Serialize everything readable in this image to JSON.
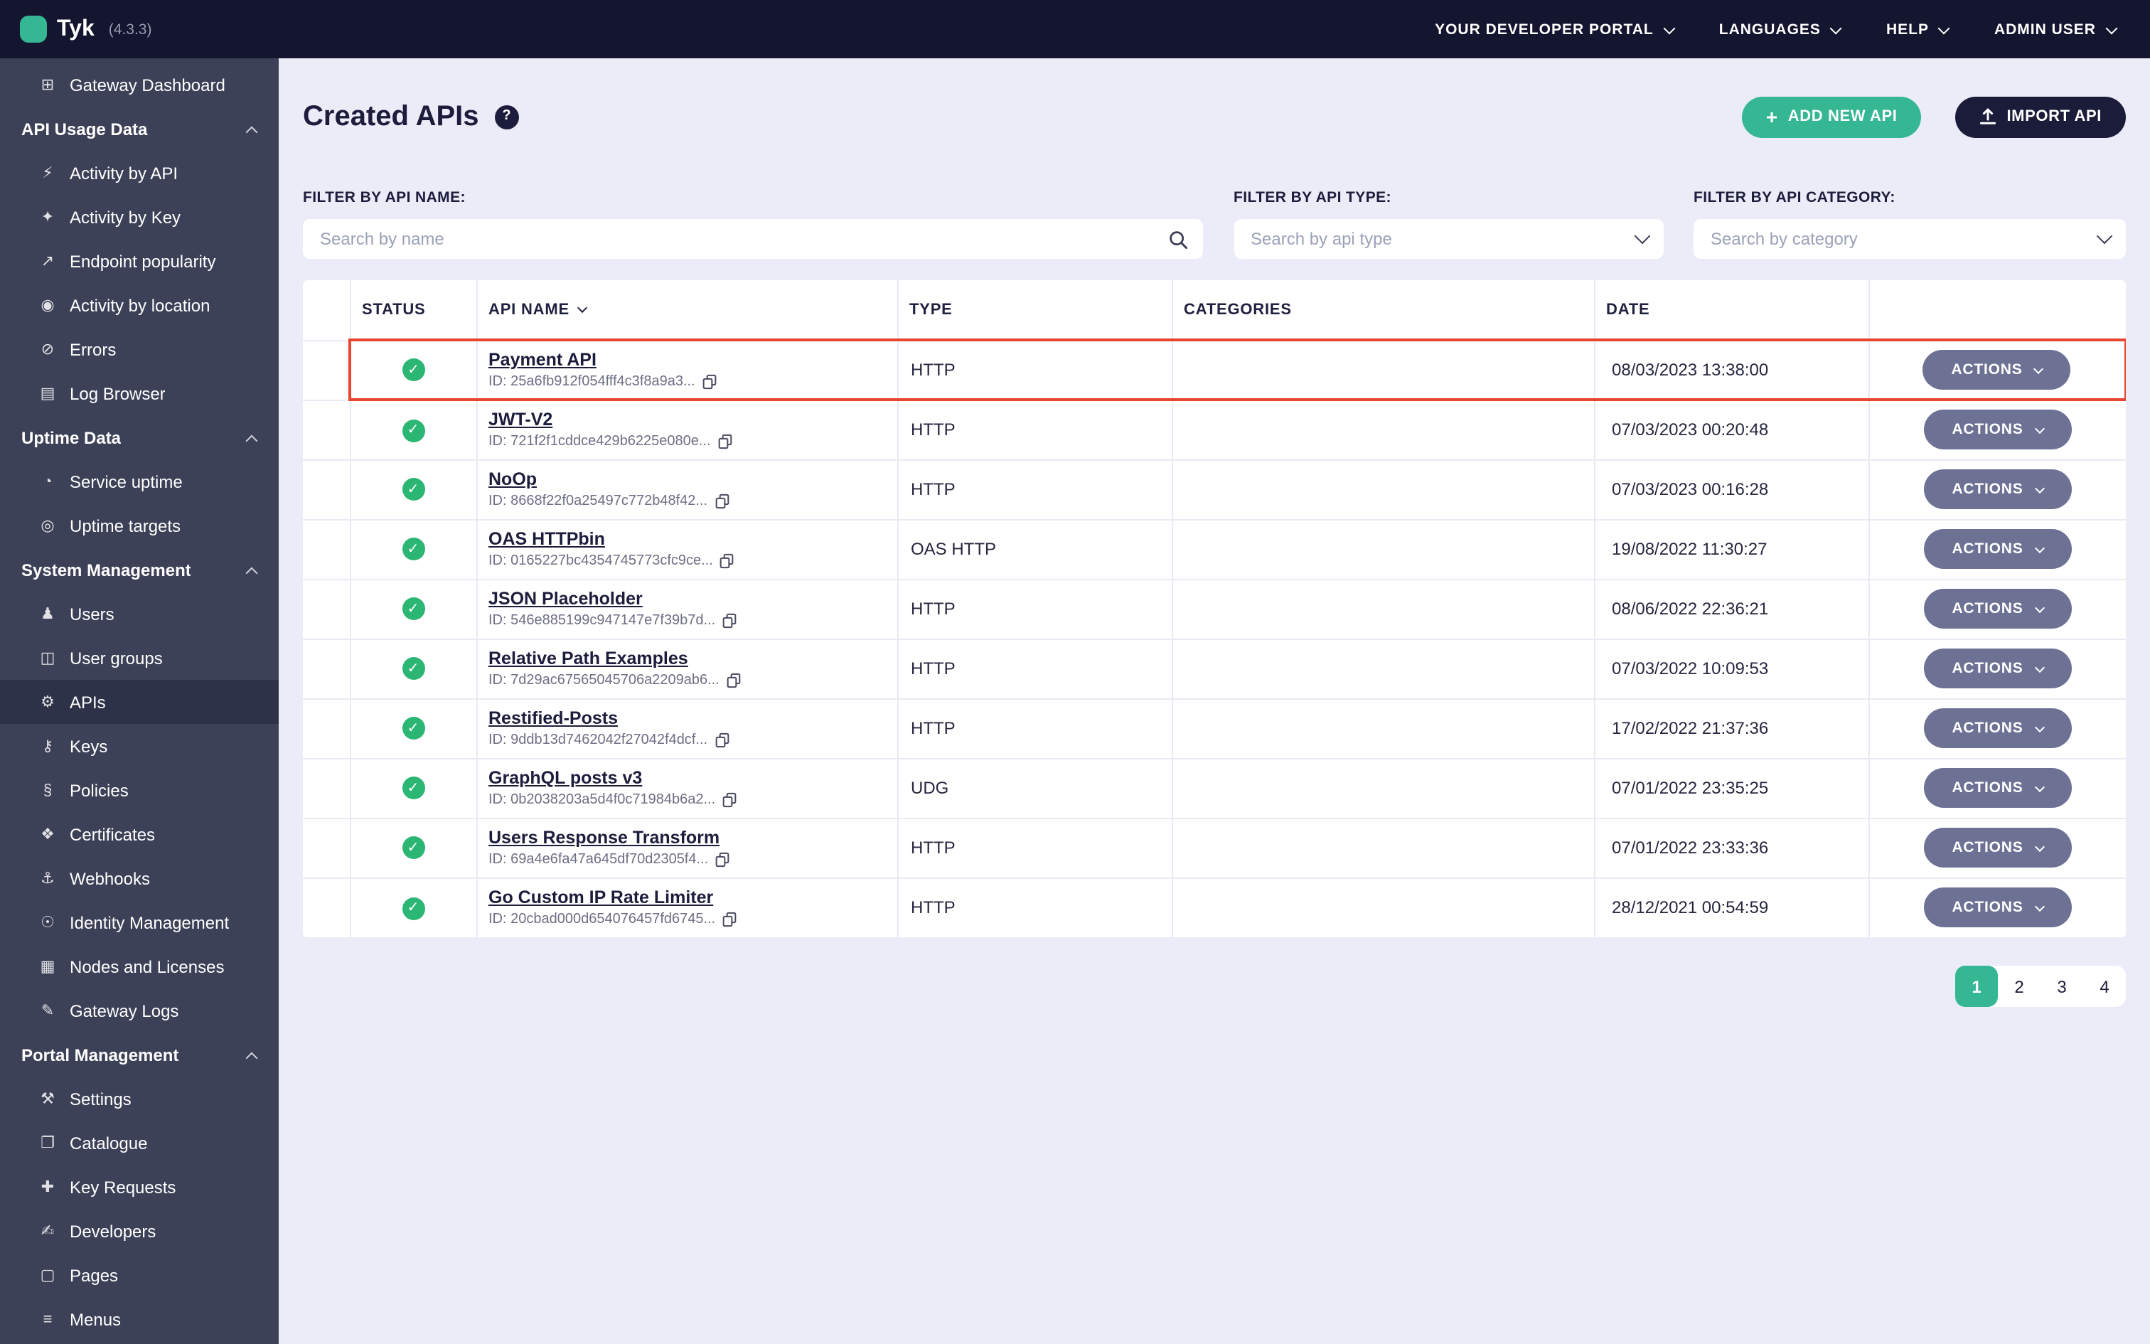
{
  "topbar": {
    "logo_text": "Tyk",
    "version": "(4.3.3)",
    "menu": [
      {
        "label": "YOUR DEVELOPER PORTAL",
        "name": "developer-portal"
      },
      {
        "label": "LANGUAGES",
        "name": "languages"
      },
      {
        "label": "HELP",
        "name": "help"
      },
      {
        "label": "ADMIN USER",
        "name": "admin-user"
      }
    ]
  },
  "sidebar": {
    "items": [
      {
        "type": "link",
        "name": "gateway-dashboard",
        "label": "Gateway Dashboard",
        "glyph": "⊞"
      },
      {
        "type": "section",
        "name": "api-usage-data",
        "label": "API Usage Data"
      },
      {
        "type": "link",
        "name": "activity-by-api",
        "label": "Activity by API",
        "glyph": "⚡"
      },
      {
        "type": "link",
        "name": "activity-by-key",
        "label": "Activity by Key",
        "glyph": "✦"
      },
      {
        "type": "link",
        "name": "endpoint-popularity",
        "label": "Endpoint popularity",
        "glyph": "↗"
      },
      {
        "type": "link",
        "name": "activity-by-location",
        "label": "Activity by location",
        "glyph": "◉"
      },
      {
        "type": "link",
        "name": "errors",
        "label": "Errors",
        "glyph": "⊘"
      },
      {
        "type": "link",
        "name": "log-browser",
        "label": "Log Browser",
        "glyph": "▤"
      },
      {
        "type": "section",
        "name": "uptime-data",
        "label": "Uptime Data"
      },
      {
        "type": "link",
        "name": "service-uptime",
        "label": "Service uptime",
        "glyph": "◔"
      },
      {
        "type": "link",
        "name": "uptime-targets",
        "label": "Uptime targets",
        "glyph": "◎"
      },
      {
        "type": "section",
        "name": "system-management",
        "label": "System Management"
      },
      {
        "type": "link",
        "name": "users",
        "label": "Users",
        "glyph": "♟"
      },
      {
        "type": "link",
        "name": "user-groups",
        "label": "User groups",
        "glyph": "◫"
      },
      {
        "type": "link",
        "name": "apis",
        "label": "APIs",
        "glyph": "⚙",
        "active": true
      },
      {
        "type": "link",
        "name": "keys",
        "label": "Keys",
        "glyph": "⚷"
      },
      {
        "type": "link",
        "name": "policies",
        "label": "Policies",
        "glyph": "§"
      },
      {
        "type": "link",
        "name": "certificates",
        "label": "Certificates",
        "glyph": "❖"
      },
      {
        "type": "link",
        "name": "webhooks",
        "label": "Webhooks",
        "glyph": "⚓"
      },
      {
        "type": "link",
        "name": "identity-management",
        "label": "Identity Management",
        "glyph": "☉"
      },
      {
        "type": "link",
        "name": "nodes-and-licenses",
        "label": "Nodes and Licenses",
        "glyph": "▦"
      },
      {
        "type": "link",
        "name": "gateway-logs",
        "label": "Gateway Logs",
        "glyph": "✎"
      },
      {
        "type": "section",
        "name": "portal-management",
        "label": "Portal Management"
      },
      {
        "type": "link",
        "name": "settings",
        "label": "Settings",
        "glyph": "⚒"
      },
      {
        "type": "link",
        "name": "catalogue",
        "label": "Catalogue",
        "glyph": "❐"
      },
      {
        "type": "link",
        "name": "key-requests",
        "label": "Key Requests",
        "glyph": "✚"
      },
      {
        "type": "link",
        "name": "developers",
        "label": "Developers",
        "glyph": "✍"
      },
      {
        "type": "link",
        "name": "pages",
        "label": "Pages",
        "glyph": "▢"
      },
      {
        "type": "link",
        "name": "menus",
        "label": "Menus",
        "glyph": "≡"
      }
    ]
  },
  "header": {
    "title": "Created APIs",
    "help": "?"
  },
  "buttons": {
    "add_new_api": {
      "label": "ADD NEW API",
      "icon": "+"
    },
    "import_api": {
      "label": "IMPORT API"
    }
  },
  "filters": [
    {
      "label": "FILTER BY API NAME:",
      "placeholder": "Search by name"
    },
    {
      "label": "FILTER BY API TYPE:",
      "placeholder": "Search by api type"
    },
    {
      "label": "FILTER BY API CATEGORY:",
      "placeholder": "Search by category"
    }
  ],
  "table": {
    "columns": [
      "",
      "STATUS",
      "API NAME",
      "TYPE",
      "CATEGORIES",
      "DATE",
      ""
    ],
    "actions_label": "ACTIONS",
    "rows": [
      {
        "name": "Payment API",
        "id": "ID: 25a6fb912f054fff4c3f8a9a3...",
        "type": "HTTP",
        "categories": "",
        "date": "08/03/2023 13:38:00",
        "status": "ok",
        "highlighted": true
      },
      {
        "name": "JWT-V2",
        "id": "ID: 721f2f1cddce429b6225e080e...",
        "type": "HTTP",
        "categories": "",
        "date": "07/03/2023 00:20:48",
        "status": "ok"
      },
      {
        "name": "NoOp",
        "id": "ID: 8668f22f0a25497c772b48f42...",
        "type": "HTTP",
        "categories": "",
        "date": "07/03/2023 00:16:28",
        "status": "ok"
      },
      {
        "name": "OAS HTTPbin",
        "id": "ID: 0165227bc4354745773cfc9ce...",
        "type": "OAS HTTP",
        "categories": "",
        "date": "19/08/2022 11:30:27",
        "status": "ok"
      },
      {
        "name": "JSON Placeholder",
        "id": "ID: 546e885199c947147e7f39b7d...",
        "type": "HTTP",
        "categories": "",
        "date": "08/06/2022 22:36:21",
        "status": "ok"
      },
      {
        "name": "Relative Path Examples",
        "id": "ID: 7d29ac67565045706a2209ab6...",
        "type": "HTTP",
        "categories": "",
        "date": "07/03/2022 10:09:53",
        "status": "ok"
      },
      {
        "name": "Restified-Posts",
        "id": "ID: 9ddb13d7462042f27042f4dcf...",
        "type": "HTTP",
        "categories": "",
        "date": "17/02/2022 21:37:36",
        "status": "ok"
      },
      {
        "name": "GraphQL posts v3",
        "id": "ID: 0b2038203a5d4f0c71984b6a2...",
        "type": "UDG",
        "categories": "",
        "date": "07/01/2022 23:35:25",
        "status": "ok"
      },
      {
        "name": "Users Response Transform",
        "id": "ID: 69a4e6fa47a645df70d2305f4...",
        "type": "HTTP",
        "categories": "",
        "date": "07/01/2022 23:33:36",
        "status": "ok"
      },
      {
        "name": "Go Custom IP Rate Limiter",
        "id": "ID: 20cbad000d654076457fd6745...",
        "type": "HTTP",
        "categories": "",
        "date": "28/12/2021 00:54:59",
        "status": "ok"
      }
    ]
  },
  "pagination": {
    "pages": [
      "1",
      "2",
      "3",
      "4"
    ],
    "active": "1"
  },
  "icons": {
    "check": "✓"
  },
  "colors": {
    "topbar_bg": "#14152e",
    "sidebar_bg": "#3d4157",
    "sidebar_active_bg": "#2e3248",
    "main_bg": "#ebecf8",
    "accent_teal": "#35b794",
    "dark_navy": "#1b1c39",
    "actions_gray": "#6d7295",
    "highlight_red": "#e8442e",
    "status_green": "#2bb673"
  }
}
